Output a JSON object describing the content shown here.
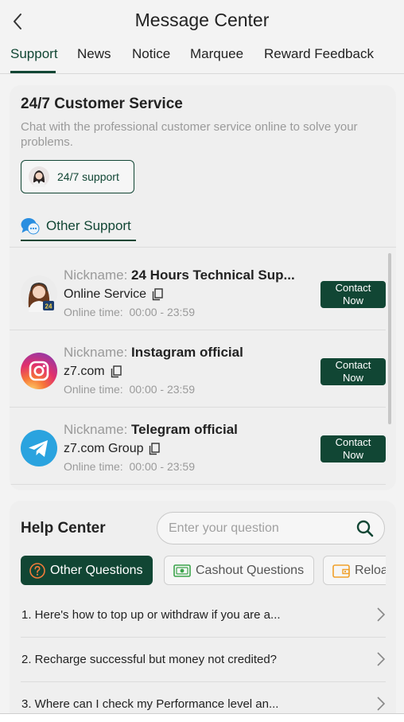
{
  "header": {
    "title": "Message Center"
  },
  "tabs": [
    {
      "label": "Support"
    },
    {
      "label": "News"
    },
    {
      "label": "Notice"
    },
    {
      "label": "Marquee"
    },
    {
      "label": "Reward Feedback"
    }
  ],
  "customer_service": {
    "title": "24/7 Customer Service",
    "description": "Chat with the professional customer service online to solve your problems.",
    "button_label": "24/7 support"
  },
  "other_support": {
    "heading": "Other Support",
    "nickname_label": "Nickname:",
    "online_time_label": "Online time:",
    "contact_label_line1": "Contact",
    "contact_label_line2": "Now",
    "contacts": [
      {
        "nickname": "24 Hours Technical Sup...",
        "account": "Online Service",
        "hours": "00:00 - 23:59",
        "badge": "24",
        "icon": "agent-avatar-icon"
      },
      {
        "nickname": "Instagram official",
        "account": "z7.com",
        "hours": "00:00 - 23:59",
        "icon": "instagram-icon"
      },
      {
        "nickname": "Telegram official",
        "account": "z7.com Group",
        "hours": "00:00 - 23:59",
        "icon": "telegram-icon"
      }
    ]
  },
  "help_center": {
    "title": "Help Center",
    "search_placeholder": "Enter your question",
    "categories": [
      {
        "label": "Other Questions",
        "icon": "question-circle-icon"
      },
      {
        "label": "Cashout Questions",
        "icon": "cash-icon"
      },
      {
        "label": "Reloa",
        "icon": "wallet-icon"
      }
    ],
    "faqs": [
      {
        "text": "1. Here's how to top up or withdraw if you are a..."
      },
      {
        "text": "2. Recharge successful but money not credited?"
      },
      {
        "text": "3. Where can I check my Performance level an..."
      }
    ]
  },
  "colors": {
    "primary": "#114634",
    "accent_orange": "#f0a02a",
    "accent_green": "#3aa34a",
    "telegram": "#2aa3df"
  }
}
